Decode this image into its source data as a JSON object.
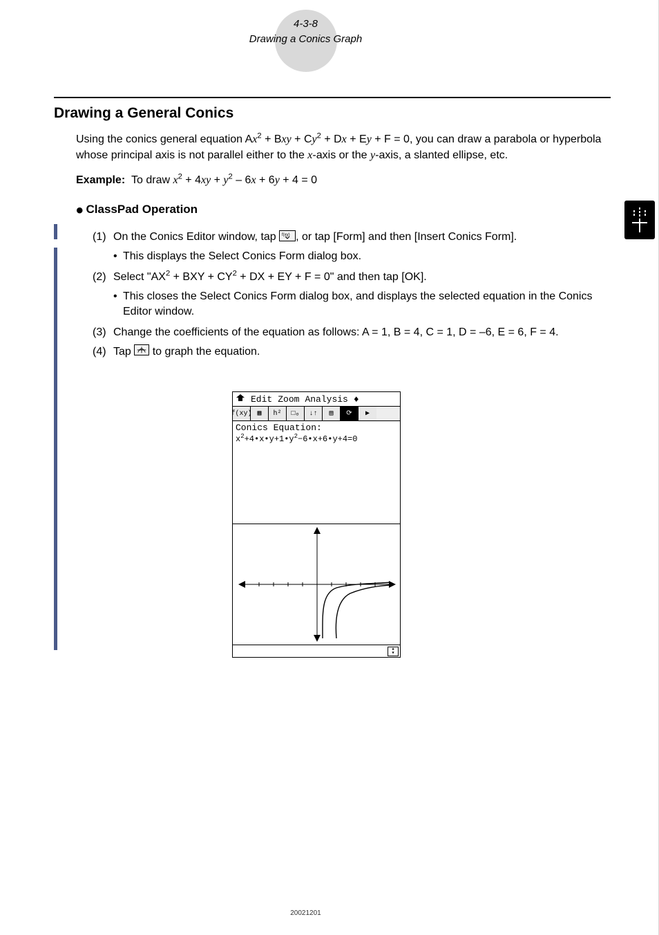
{
  "header": {
    "page_ref": "4-3-8",
    "subtitle": "Drawing a Conics Graph"
  },
  "h2": "Drawing a General Conics",
  "intro_html": "Using the conics general equation A<span class='ital'>x</span><sup>2</sup> + B<span class='ital'>xy</span> + C<span class='ital'>y</span><sup>2</sup> + D<span class='ital'>x</span> + E<span class='ital'>y</span> + F = 0, you can draw a parabola or hyperbola whose principal axis is not parallel either to the <span class='ital'>x</span>-axis or the <span class='ital'>y</span>-axis, a slanted ellipse, etc.",
  "example_label": "Example:",
  "example_body_html": "To draw <span class='ital'>x</span><sup>2</sup> + 4<span class='ital'>xy</span> + <span class='ital'>y</span><sup>2</sup> – 6<span class='ital'>x</span> + 6<span class='ital'>y</span> + 4 = 0",
  "op_head": "ClassPad Operation",
  "steps": {
    "s1_num": "(1)",
    "s1_txt_a": "On the Conics Editor window, tap ",
    "s1_txt_b": ", or tap [Form] and then [Insert Conics Form].",
    "s1_sub": "This displays the Select Conics Form dialog box.",
    "s2_num": "(2)",
    "s2_txt_html": "Select \"AX<sup>2</sup> + BXY + CY<sup>2</sup> + DX + EY + F = 0\" and then tap [OK].",
    "s2_sub": "This closes the Select Conics Form dialog box, and displays the selected equation in the Conics Editor window.",
    "s3_num": "(3)",
    "s3_txt": "Change the coefficients of the equation as follows: A = 1, B = 4, C = 1, D = –6, E = 6, F = 4.",
    "s4_num": "(4)",
    "s4_txt_a": "Tap ",
    "s4_txt_b": " to graph the equation."
  },
  "icons": {
    "form_icon_label": "f(xy)↓",
    "graph_icon_label": "graph"
  },
  "screenshot": {
    "menu": {
      "i1": "❖",
      "i2": "Edit",
      "i3": "Zoom",
      "i4": "Analysis",
      "i5": "♦"
    },
    "toolbar": [
      "f(xy)",
      "▦",
      "h²",
      "□ₒ",
      "↓↑",
      "▤",
      "⟳",
      "▶"
    ],
    "eq_label": "Conics Equation:",
    "eq_html": "x<sup>2</sup>+4•x•y+1•y<sup>2</sup>−6•x+6•y+4=0"
  },
  "footer": "20021201"
}
